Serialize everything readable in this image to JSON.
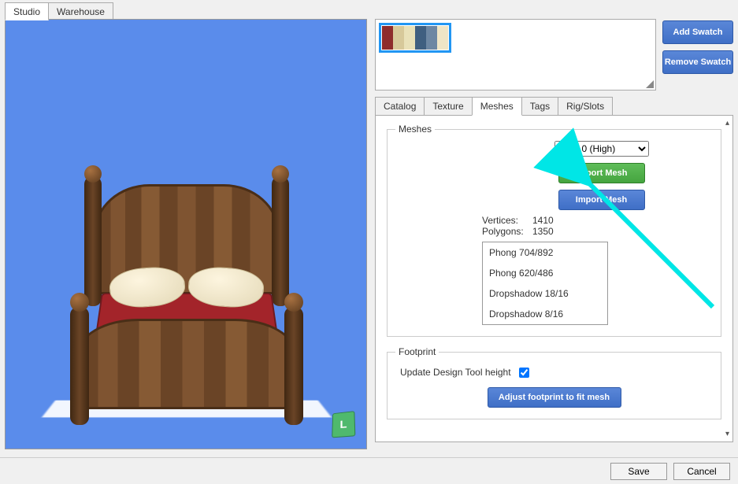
{
  "top_tabs": {
    "studio": "Studio",
    "warehouse": "Warehouse"
  },
  "swatch_buttons": {
    "add": "Add Swatch",
    "remove": "Remove Swatch"
  },
  "swatches": {
    "colors": [
      "#8e2c2c",
      "#d7c99a",
      "#e9e1b8",
      "#3f5f80",
      "#6d87a3",
      "#efe5c6"
    ]
  },
  "detail_tabs": {
    "catalog": "Catalog",
    "texture": "Texture",
    "meshes": "Meshes",
    "tags": "Tags",
    "rigslots": "Rig/Slots"
  },
  "meshes": {
    "legend": "Meshes",
    "lod_selected": "LOD 0 (High)",
    "export": "Export Mesh",
    "import": "Import Mesh",
    "vertices_label": "Vertices:",
    "vertices_value": "1410",
    "polygons_label": "Polygons:",
    "polygons_value": "1350",
    "entries": [
      "Phong 704/892",
      "Phong 620/486",
      "Dropshadow 18/16",
      "Dropshadow 8/16"
    ]
  },
  "footprint": {
    "legend": "Footprint",
    "update_label": "Update Design Tool height",
    "adjust": "Adjust footprint to fit mesh"
  },
  "bottom": {
    "save": "Save",
    "cancel": "Cancel"
  },
  "preview": {
    "badge": "L"
  }
}
